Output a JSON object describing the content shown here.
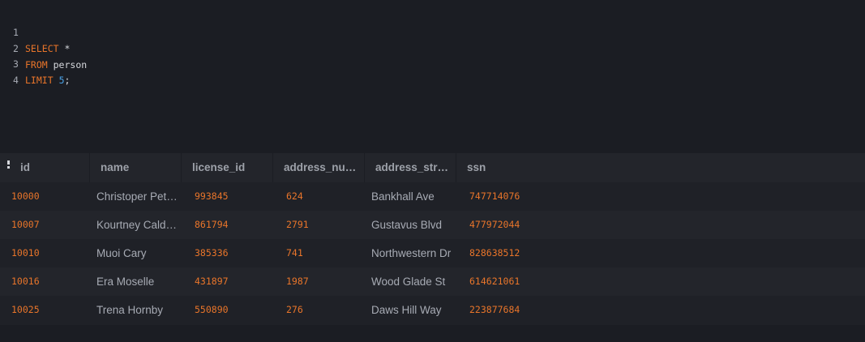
{
  "editor": {
    "lines": [
      {
        "number": "1",
        "keyword": "SELECT",
        "rest": " *"
      },
      {
        "number": "2",
        "keyword": "FROM",
        "rest": " person"
      },
      {
        "number": "3",
        "keyword": "LIMIT",
        "number_literal": "5",
        "rest": ";"
      },
      {
        "number": "4"
      }
    ]
  },
  "results": {
    "columns": [
      "id",
      "name",
      "license_id",
      "address_nu…",
      "address_str…",
      "ssn"
    ],
    "rows": [
      {
        "id": "10000",
        "name": "Christoper Pet…",
        "license_id": "993845",
        "address_number": "624",
        "address_street": "Bankhall Ave",
        "ssn": "747714076"
      },
      {
        "id": "10007",
        "name": "Kourtney Cald…",
        "license_id": "861794",
        "address_number": "2791",
        "address_street": "Gustavus Blvd",
        "ssn": "477972044"
      },
      {
        "id": "10010",
        "name": "Muoi Cary",
        "license_id": "385336",
        "address_number": "741",
        "address_street": "Northwestern Dr",
        "ssn": "828638512"
      },
      {
        "id": "10016",
        "name": "Era Moselle",
        "license_id": "431897",
        "address_number": "1987",
        "address_street": "Wood Glade St",
        "ssn": "614621061"
      },
      {
        "id": "10025",
        "name": "Trena Hornby",
        "license_id": "550890",
        "address_number": "276",
        "address_street": "Daws Hill Way",
        "ssn": "223877684"
      }
    ]
  },
  "icons": {
    "grid_menu": "vertical-more-icon"
  },
  "colors": {
    "keyword": "#e9752a",
    "number_literal": "#4aa3e8",
    "text": "#d6d8dd",
    "cell_value": "#e9752a",
    "cell_text": "#a7abb4",
    "header_text": "#9da1a9"
  }
}
